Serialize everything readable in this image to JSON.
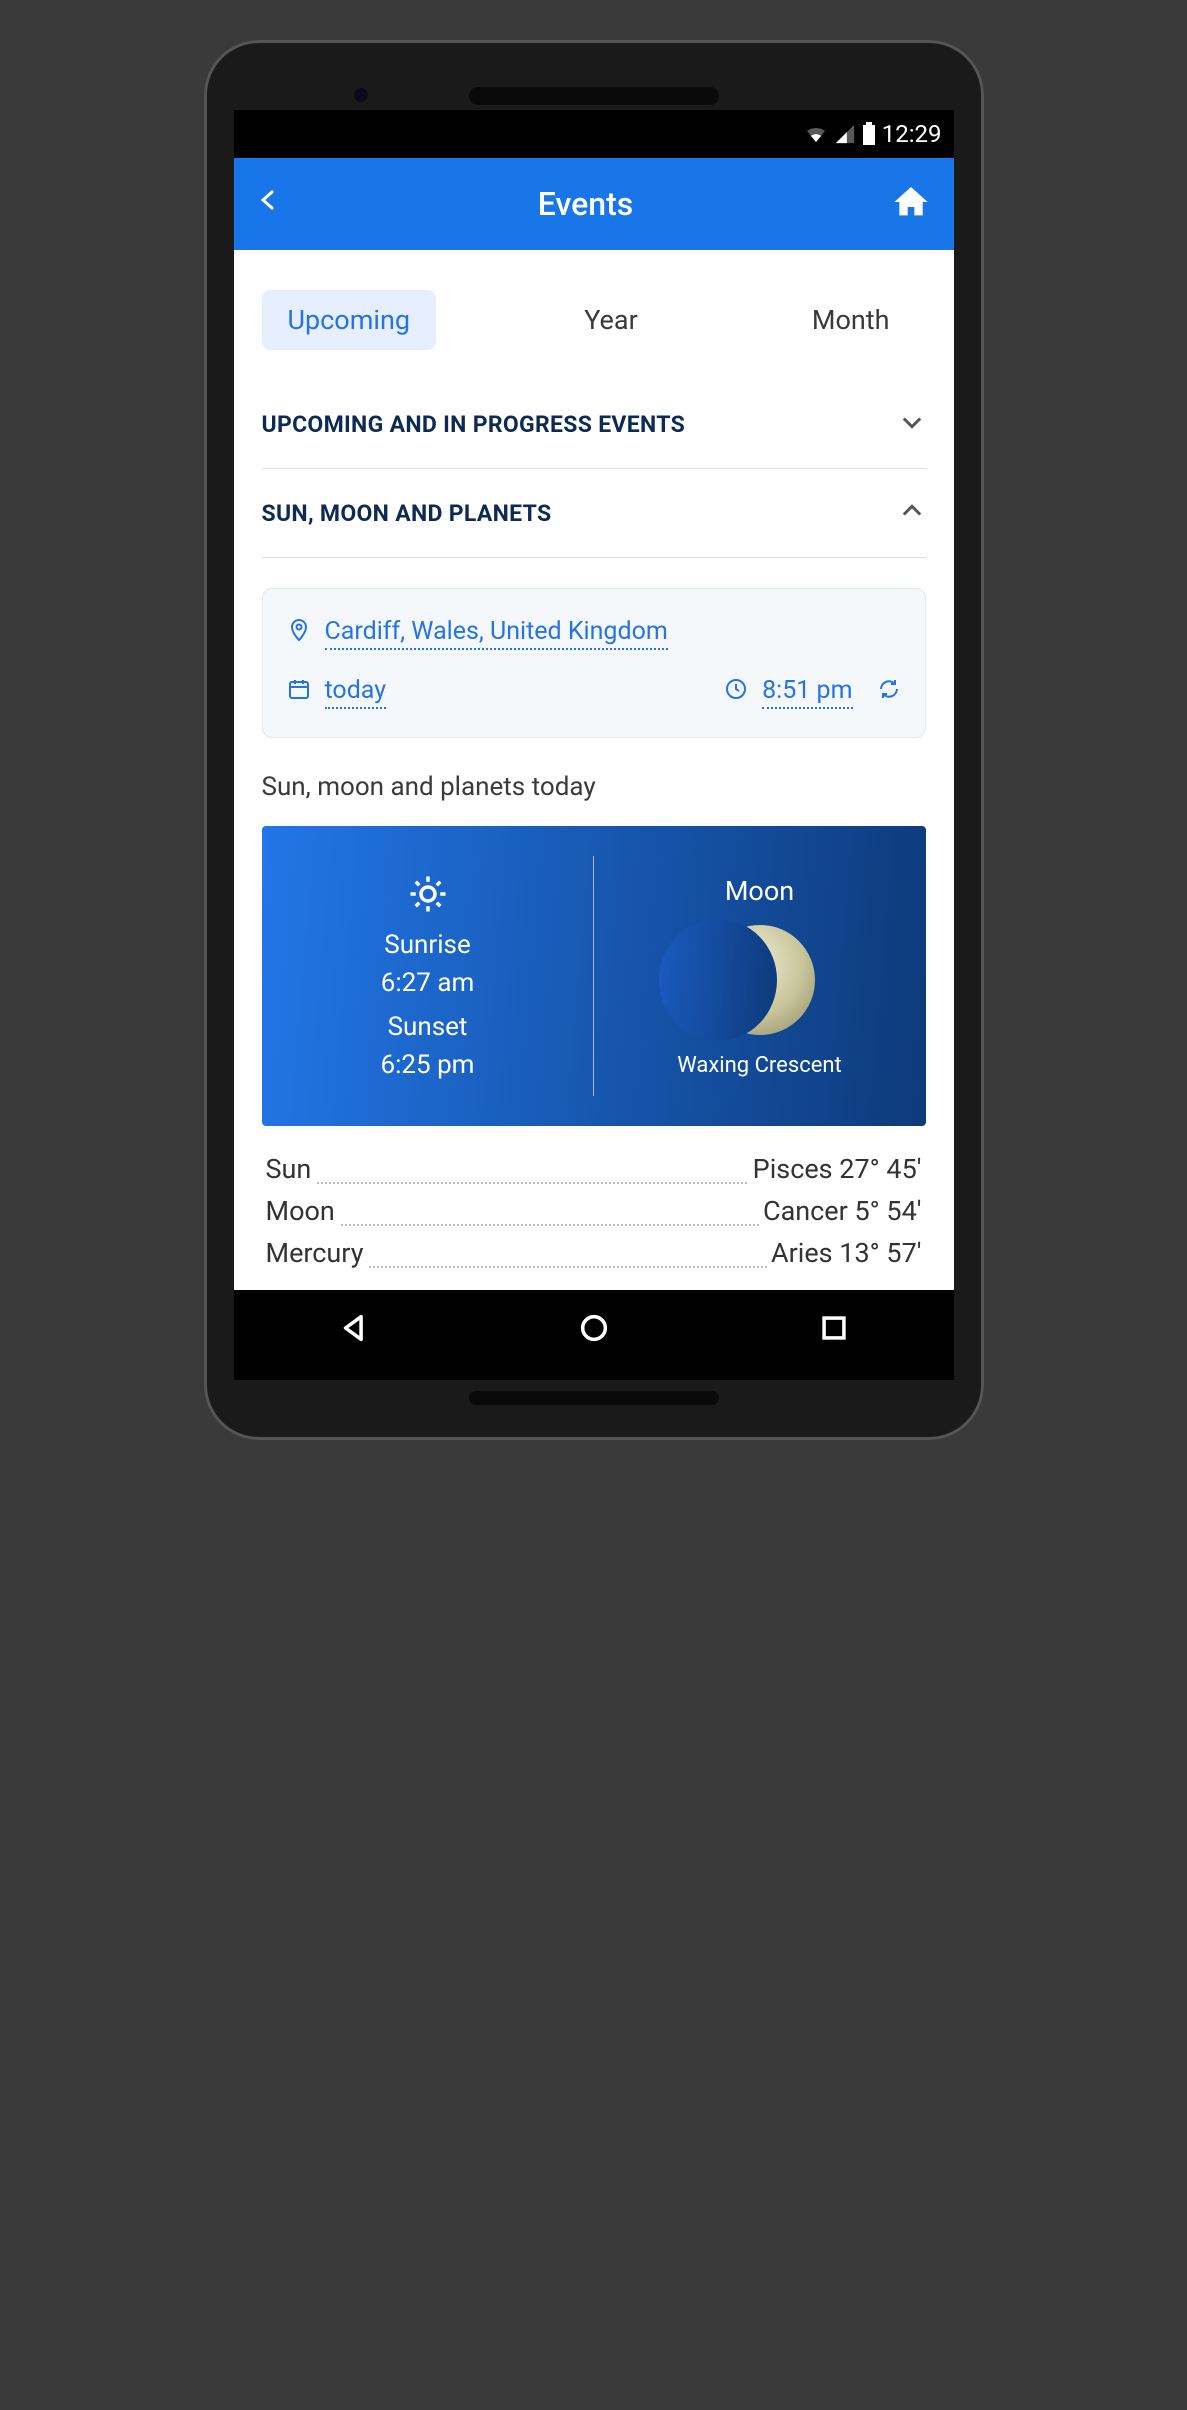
{
  "status_bar": {
    "time": "12:29"
  },
  "app_bar": {
    "title": "Events"
  },
  "tabs": [
    {
      "label": "Upcoming",
      "active": true
    },
    {
      "label": "Year",
      "active": false
    },
    {
      "label": "Month",
      "active": false
    }
  ],
  "accordions": {
    "upcoming": "UPCOMING AND IN PROGRESS EVENTS",
    "sun_moon": "SUN, MOON AND PLANETS"
  },
  "filters": {
    "location": "Cardiff, Wales, United Kingdom",
    "date": "today",
    "time": "8:51 pm"
  },
  "section_title": "Sun, moon and planets today",
  "sky": {
    "sunrise_label": "Sunrise",
    "sunrise_time": "6:27 am",
    "sunset_label": "Sunset",
    "sunset_time": "6:25 pm",
    "moon_label": "Moon",
    "moon_phase": "Waxing Crescent"
  },
  "positions": [
    {
      "body": "Sun",
      "pos": "Pisces 27° 45'"
    },
    {
      "body": "Moon",
      "pos": "Cancer 5° 54'"
    },
    {
      "body": "Mercury",
      "pos": "Aries 13° 57'"
    }
  ]
}
